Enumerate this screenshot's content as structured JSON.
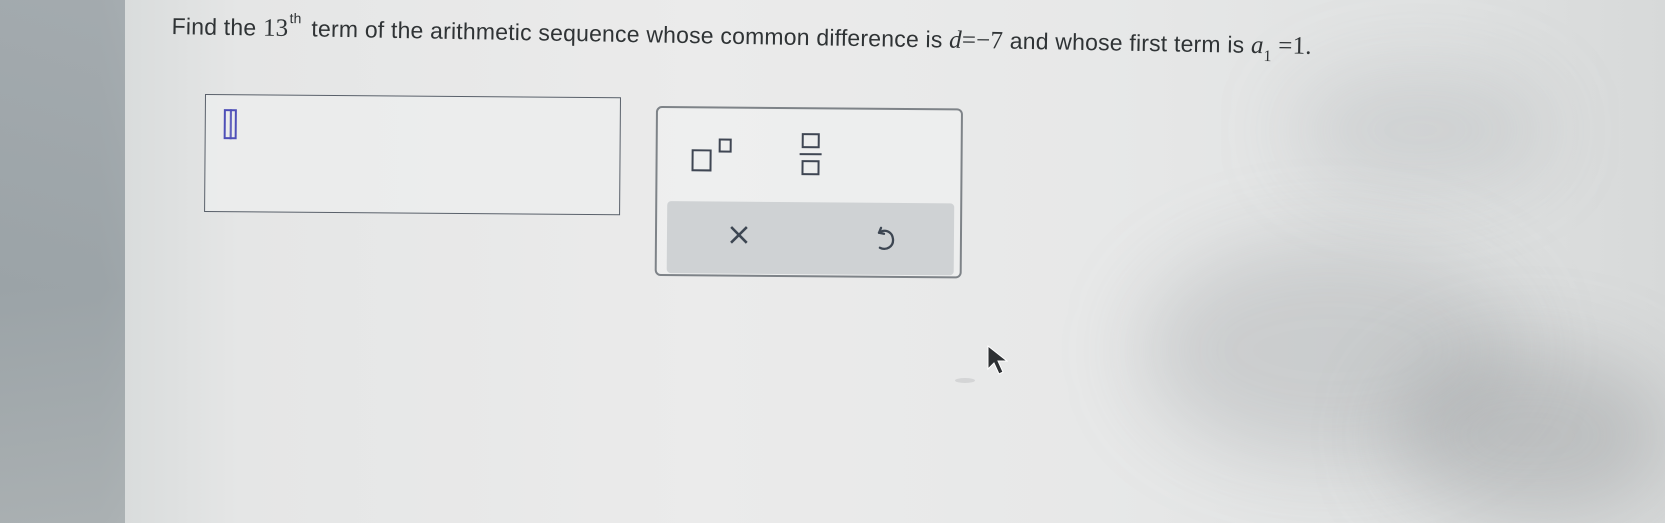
{
  "question": {
    "part1": "Find the ",
    "term_number": "13",
    "ordinal_suffix": "th",
    "part2": "term of the arithmetic sequence whose common difference is ",
    "d_symbol": "d",
    "equals1": "=",
    "d_value": "−7",
    "part3": " and whose first term is ",
    "a_symbol": "a",
    "a_subscript": "1",
    "equals2": " =",
    "a_value": "1",
    "end_punctuation": "."
  },
  "answer_input": {
    "value": ""
  },
  "math_tools": {
    "icons": [
      "superscript-icon",
      "fraction-icon"
    ]
  },
  "actions": {
    "clear_label": "×",
    "undo_icon": "undo-icon"
  },
  "colors": {
    "cursor": "#4e4fb8",
    "text": "#2f3335",
    "border": "#59606a",
    "action_band": "#cfd2d4"
  }
}
